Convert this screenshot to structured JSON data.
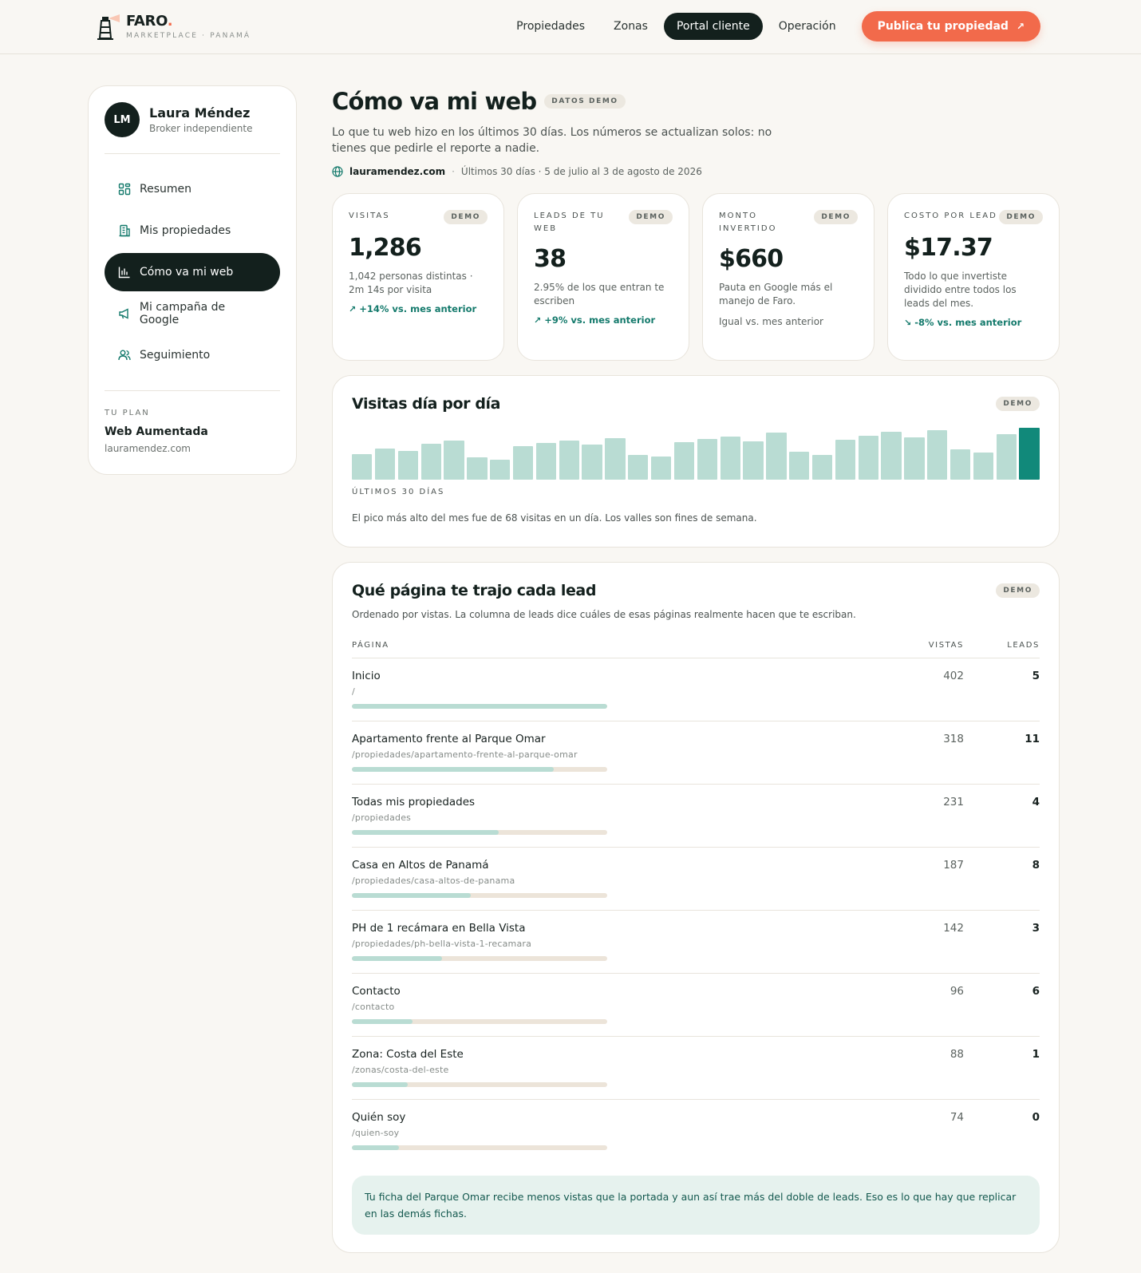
{
  "brand": {
    "name": "FARO",
    "dot": ".",
    "tagline": "MARKETPLACE · PANAMÁ"
  },
  "nav": {
    "links": [
      {
        "label": "Propiedades",
        "active": false
      },
      {
        "label": "Zonas",
        "active": false
      },
      {
        "label": "Portal cliente",
        "active": true
      },
      {
        "label": "Operación",
        "active": false
      }
    ],
    "cta": "Publica tu propiedad",
    "cta_icon": "↗"
  },
  "sidebar": {
    "initials": "LM",
    "name": "Laura Méndez",
    "role": "Broker independiente",
    "items": [
      {
        "label": "Resumen",
        "icon": "grid-icon",
        "active": false
      },
      {
        "label": "Mis propiedades",
        "icon": "building-icon",
        "active": false
      },
      {
        "label": "Cómo va mi web",
        "icon": "bar-chart-icon",
        "active": true
      },
      {
        "label": "Mi campaña de Google",
        "icon": "megaphone-icon",
        "active": false
      },
      {
        "label": "Seguimiento",
        "icon": "users-icon",
        "active": false
      }
    ],
    "plan": {
      "label": "TU PLAN",
      "name": "Web Aumentada",
      "domain": "lauramendez.com"
    }
  },
  "page": {
    "title": "Cómo va mi web",
    "badge": "DATOS DEMO",
    "subtitle": "Lo que tu web hizo en los últimos 30 días. Los números se actualizan solos: no tienes que pedirle el reporte a nadie.",
    "domain": "lauramendez.com",
    "separator": "·",
    "period": "Últimos 30 días · 5 de julio al 3 de agosto de 2026"
  },
  "kpis": [
    {
      "label": "VISITAS",
      "badge": "DEMO",
      "value": "1,286",
      "desc": "1,042 personas distintas · 2m 14s por visita",
      "note": "",
      "trend": "+14% vs. mes anterior",
      "trend_dir": "up"
    },
    {
      "label": "LEADS DE TU WEB",
      "badge": "DEMO",
      "value": "38",
      "desc": "2.95% de los que entran te escriben",
      "note": "",
      "trend": "+9% vs. mes anterior",
      "trend_dir": "up"
    },
    {
      "label": "MONTO INVERTIDO",
      "badge": "DEMO",
      "value": "$660",
      "desc": "Pauta en Google más el manejo de Faro.",
      "note": "Igual vs. mes anterior",
      "trend": "",
      "trend_dir": "flat"
    },
    {
      "label": "COSTO POR LEAD",
      "badge": "DEMO",
      "value": "$17.37",
      "desc": "Todo lo que invertiste dividido entre todos los leads del mes.",
      "note": "",
      "trend": "-8% vs. mes anterior",
      "trend_dir": "down"
    }
  ],
  "chart_data": {
    "type": "bar",
    "title": "Visitas día por día",
    "badge": "DEMO",
    "xlabel": "ÚLTIMOS 30 DÍAS",
    "ylim": [
      0,
      68
    ],
    "highlight_color": "#11897a",
    "bar_color": "#b9dcd3",
    "values": [
      32,
      39,
      36,
      45,
      49,
      28,
      25,
      42,
      46,
      49,
      44,
      52,
      31,
      29,
      47,
      51,
      54,
      48,
      59,
      35,
      31,
      50,
      55,
      60,
      53,
      62,
      38,
      34,
      57,
      65
    ],
    "note": "El pico más alto del mes fue de 68 visitas en un día. Los valles son fines de semana."
  },
  "pages_table": {
    "title": "Qué página te trajo cada lead",
    "badge": "DEMO",
    "desc": "Ordenado por vistas. La columna de leads dice cuáles de esas páginas realmente hacen que te escriban.",
    "headers": {
      "page": "PÁGINA",
      "views": "VISTAS",
      "leads": "LEADS"
    },
    "rows": [
      {
        "name": "Inicio",
        "path": "/",
        "views": 402,
        "leads": 5
      },
      {
        "name": "Apartamento frente al Parque Omar",
        "path": "/propiedades/apartamento-frente-al-parque-omar",
        "views": 318,
        "leads": 11
      },
      {
        "name": "Todas mis propiedades",
        "path": "/propiedades",
        "views": 231,
        "leads": 4
      },
      {
        "name": "Casa en Altos de Panamá",
        "path": "/propiedades/casa-altos-de-panama",
        "views": 187,
        "leads": 8
      },
      {
        "name": "PH de 1 recámara en Bella Vista",
        "path": "/propiedades/ph-bella-vista-1-recamara",
        "views": 142,
        "leads": 3
      },
      {
        "name": "Contacto",
        "path": "/contacto",
        "views": 96,
        "leads": 6
      },
      {
        "name": "Zona: Costa del Este",
        "path": "/zonas/costa-del-este",
        "views": 88,
        "leads": 1
      },
      {
        "name": "Quién soy",
        "path": "/quien-soy",
        "views": 74,
        "leads": 0
      }
    ],
    "insight": "Tu ficha del Parque Omar recibe menos vistas que la portada y aun así trae más del doble de leads. Eso es lo que hay que replicar en las demás fichas."
  }
}
